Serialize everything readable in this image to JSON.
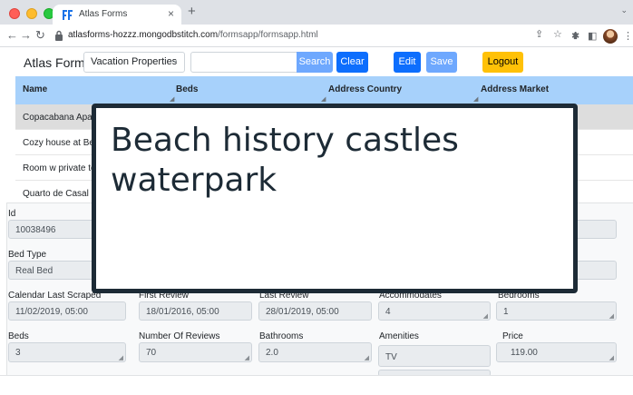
{
  "browser": {
    "tab_title": "Atlas Forms",
    "tab_close": "×",
    "new_tab": "+",
    "menu_chevron": "⌄",
    "url_domain": "atlasforms-hozzz.mongodbstitch.com",
    "url_path": "/formsapp/formsapp.html",
    "icons": [
      "back-icon",
      "forward-icon",
      "reload-icon",
      "lock-icon",
      "share-icon",
      "bookmark-star-icon",
      "extension-icon",
      "puzzle-icon",
      "sidebar-icon",
      "profile-avatar",
      "kebab-menu-icon"
    ]
  },
  "app": {
    "brand": "Atlas Forms",
    "collection_select": "Vacation Properties",
    "search_placeholder": "",
    "buttons": {
      "search": "Search",
      "clear": "Clear",
      "edit": "Edit",
      "save": "Save",
      "logout": "Logout"
    },
    "colors": {
      "primary": "#0d6efd",
      "primary_disabled": "#6ea8fe",
      "warning": "#ffc107",
      "header_bg": "#a7d1fb",
      "selected_row": "#dddddd"
    }
  },
  "grid": {
    "columns": [
      "Name",
      "Beds",
      "Address Country",
      "Address Market"
    ],
    "rows": [
      {
        "name": "Copacabana Apart",
        "selected": true
      },
      {
        "name": "Cozy house at Bey",
        "selected": false
      },
      {
        "name": "Room w private to",
        "selected": false
      },
      {
        "name": "Quarto de Casal e",
        "selected": false
      }
    ]
  },
  "form": {
    "id_label": "Id",
    "id_value": "10038496",
    "bed_type_label": "Bed Type",
    "bed_type_value": "Real Bed",
    "calendar_label": "Calendar Last Scraped",
    "calendar_value": "11/02/2019, 05:00",
    "first_review_label": "First Review",
    "first_review_value": "18/01/2016, 05:00",
    "last_review_label": "Last Review",
    "last_review_value": "28/01/2019, 05:00",
    "accommodates_label": "Accommodates",
    "accommodates_value": "4",
    "bedrooms_label": "Bedrooms",
    "bedrooms_value": "1",
    "beds_label": "Beds",
    "beds_value": "3",
    "reviews_label": "Number Of Reviews",
    "reviews_value": "70",
    "bathrooms_label": "Bathrooms",
    "bathrooms_value": "2.0",
    "amenities_label": "Amenities",
    "amenities_value": "TV",
    "price_label": "Price",
    "price_value": "119.00"
  },
  "overlay": {
    "text": "Beach history castles waterpark"
  }
}
